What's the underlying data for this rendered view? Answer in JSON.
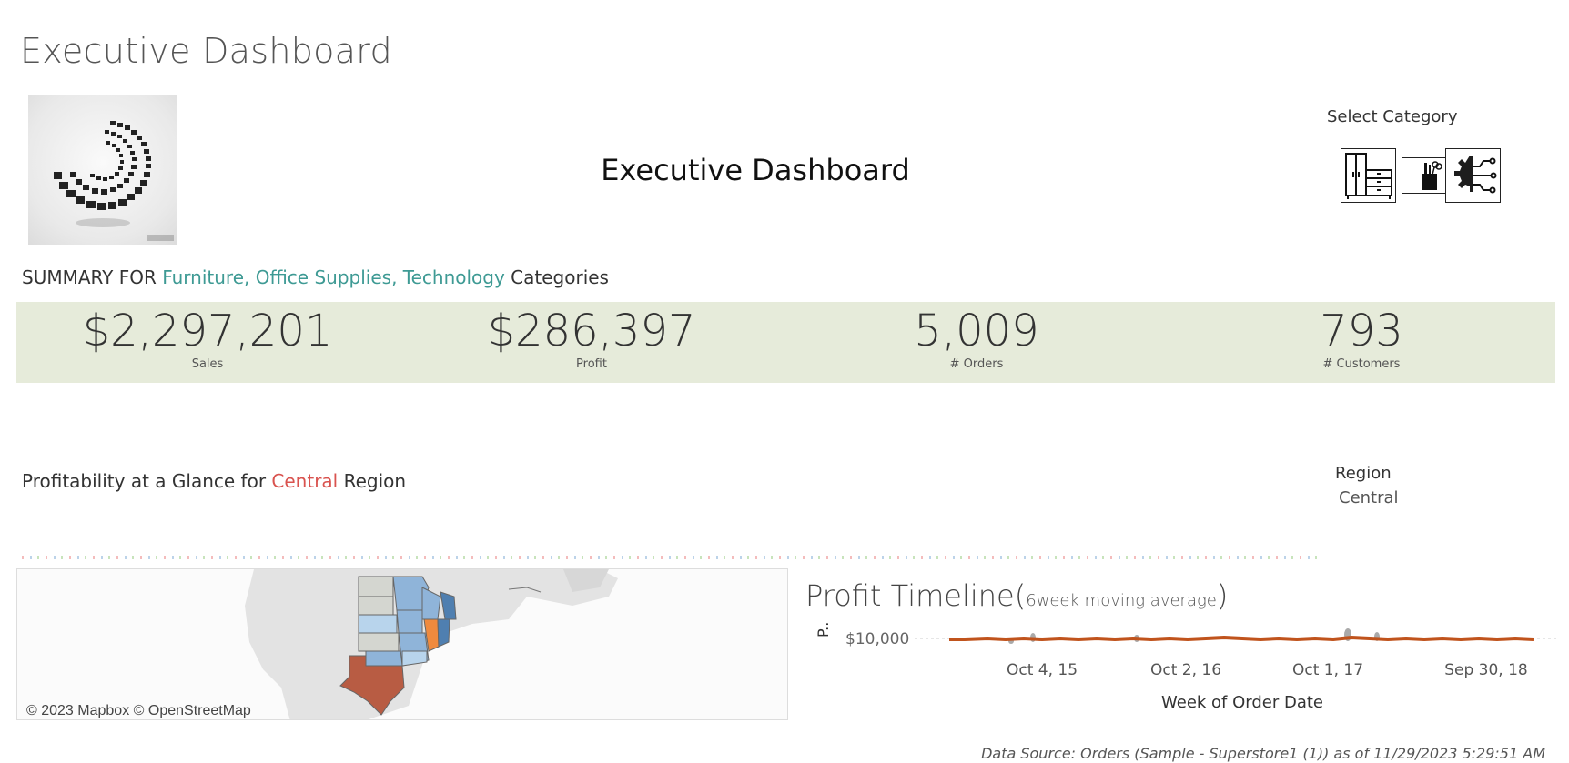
{
  "page_title": "Executive Dashboard",
  "header": {
    "center_title": "Executive Dashboard",
    "select_category_label": "Select Category",
    "category_buttons": [
      {
        "name": "Furniture",
        "icon": "furniture-icon"
      },
      {
        "name": "Office Supplies",
        "icon": "office-supplies-icon"
      },
      {
        "name": "Technology",
        "icon": "technology-icon"
      }
    ]
  },
  "summary": {
    "prefix": "SUMMARY FOR ",
    "categories": "Furniture, Office Supplies, Technology",
    "suffix": " Categories"
  },
  "kpis": [
    {
      "value": "$2,297,201",
      "label": "Sales"
    },
    {
      "value": "$286,397",
      "label": "Profit"
    },
    {
      "value": "5,009",
      "label": "# Orders"
    },
    {
      "value": "793",
      "label": "# Customers"
    }
  ],
  "profitability": {
    "prefix": "Profitability at a Glance for ",
    "region": "Central",
    "suffix": " Region"
  },
  "region_legend": {
    "title": "Region",
    "value": "Central"
  },
  "map": {
    "credit": "© 2023 Mapbox © OpenStreetMap",
    "colors": {
      "high": "#4f7fb0",
      "mid": "#8fb4d9",
      "low": "#b8d4ec",
      "neutral": "#d4d6d0",
      "loss_high": "#b85c43",
      "loss_mid": "#ef8a3e"
    }
  },
  "timeline": {
    "title": "Profit Timeline(",
    "subtitle": "6week moving average",
    "title_close": ")",
    "y_axis_abbrev": "P..",
    "y_tick": "$10,000",
    "x_ticks": [
      "Oct 4, 15",
      "Oct 2, 16",
      "Oct 1, 17",
      "Sep 30, 18"
    ],
    "x_axis_title": "Week of Order Date",
    "line_color": "#c0531c"
  },
  "data_source": "Data Source: Orders (Sample - Superstore1 (1)) as of 11/29/2023 5:29:51 AM"
}
